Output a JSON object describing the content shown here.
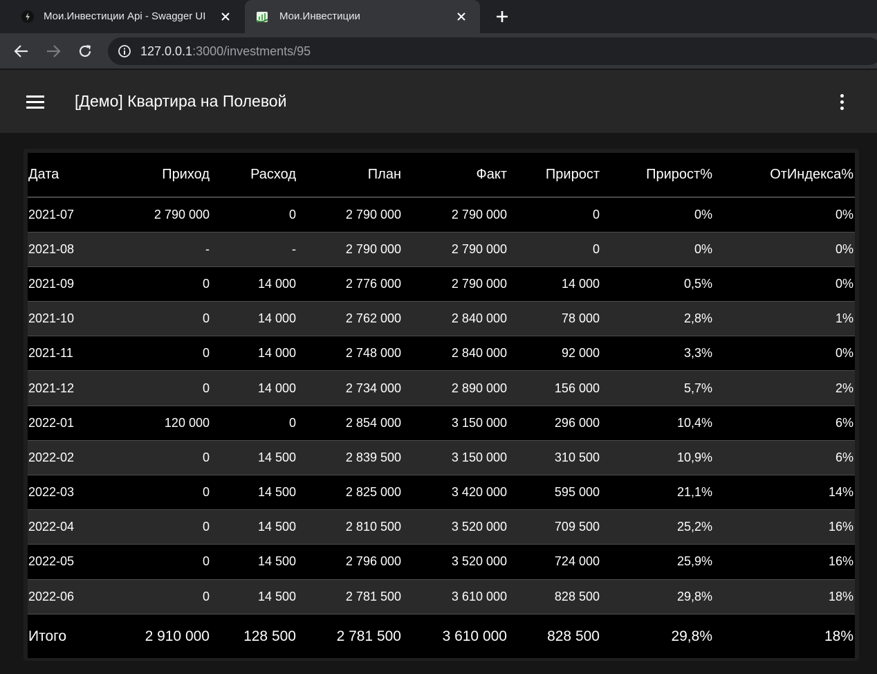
{
  "browser": {
    "tabs": [
      {
        "title": "Мои.Инвестиции Api - Swagger UI",
        "active": false,
        "favicon": "swagger-icon"
      },
      {
        "title": "Мои.Инвестиции",
        "active": true,
        "favicon": "app-icon"
      }
    ],
    "url_host": "127.0.0.1",
    "url_rest": ":3000/investments/95"
  },
  "appbar": {
    "title": "[Демо] Квартира на Полевой"
  },
  "table": {
    "columns": [
      "Дата",
      "Приход",
      "Расход",
      "План",
      "Факт",
      "Прирост",
      "Прирост%",
      "ОтИндекса%"
    ],
    "rows": [
      [
        "2021-07",
        "2 790 000",
        "0",
        "2 790 000",
        "2 790 000",
        "0",
        "0%",
        "0%"
      ],
      [
        "2021-08",
        "-",
        "-",
        "2 790 000",
        "2 790 000",
        "0",
        "0%",
        "0%"
      ],
      [
        "2021-09",
        "0",
        "14 000",
        "2 776 000",
        "2 790 000",
        "14 000",
        "0,5%",
        "0%"
      ],
      [
        "2021-10",
        "0",
        "14 000",
        "2 762 000",
        "2 840 000",
        "78 000",
        "2,8%",
        "1%"
      ],
      [
        "2021-11",
        "0",
        "14 000",
        "2 748 000",
        "2 840 000",
        "92 000",
        "3,3%",
        "0%"
      ],
      [
        "2021-12",
        "0",
        "14 000",
        "2 734 000",
        "2 890 000",
        "156 000",
        "5,7%",
        "2%"
      ],
      [
        "2022-01",
        "120 000",
        "0",
        "2 854 000",
        "3 150 000",
        "296 000",
        "10,4%",
        "6%"
      ],
      [
        "2022-02",
        "0",
        "14 500",
        "2 839 500",
        "3 150 000",
        "310 500",
        "10,9%",
        "6%"
      ],
      [
        "2022-03",
        "0",
        "14 500",
        "2 825 000",
        "3 420 000",
        "595 000",
        "21,1%",
        "14%"
      ],
      [
        "2022-04",
        "0",
        "14 500",
        "2 810 500",
        "3 520 000",
        "709 500",
        "25,2%",
        "16%"
      ],
      [
        "2022-05",
        "0",
        "14 500",
        "2 796 000",
        "3 520 000",
        "724 000",
        "25,9%",
        "16%"
      ],
      [
        "2022-06",
        "0",
        "14 500",
        "2 781 500",
        "3 610 000",
        "828 500",
        "29,8%",
        "18%"
      ]
    ],
    "totals": [
      "Итого",
      "2 910 000",
      "128 500",
      "2 781 500",
      "3 610 000",
      "828 500",
      "29,8%",
      "18%"
    ]
  }
}
